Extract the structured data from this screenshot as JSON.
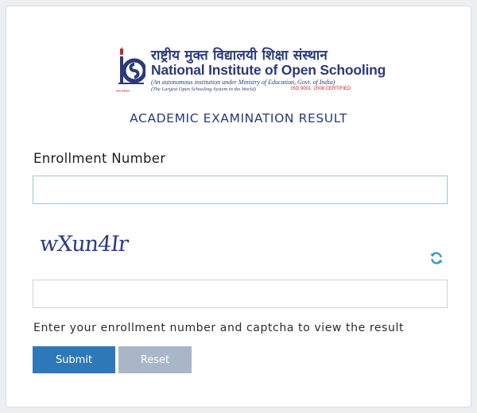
{
  "logo": {
    "hindi_name": "राष्ट्रीय मुक्त विद्यालयी शिक्षा संस्थान",
    "english_name": "National Institute of Open Schooling",
    "subtitle": "(An autonomous institution under Ministry of Education, Govt. of India)",
    "tagline": "(The Largest Open Schooling System in the World)",
    "iso": "ISO 9001: 2008 CERTIFIED",
    "emblem_caption": "ज्ञान संस्थान",
    "emblem_letters": "OS",
    "icon": "nios-emblem-icon"
  },
  "title": "ACADEMIC EXAMINATION RESULT",
  "form": {
    "enrollment_label": "Enrollment Number",
    "enrollment_value": "",
    "enrollment_placeholder": "",
    "captcha_text": "wXun4Ir",
    "captcha_value": "",
    "captcha_placeholder": "",
    "refresh_icon": "refresh-icon",
    "help_text": "Enter your enrollment number and captcha to view the result",
    "submit_label": "Submit",
    "reset_label": "Reset"
  },
  "colors": {
    "brand": "#2b3a78",
    "accent_red": "#c0272d",
    "submit": "#2f78b7",
    "reset": "#a8b6c8",
    "refresh": "#3a98c9"
  }
}
